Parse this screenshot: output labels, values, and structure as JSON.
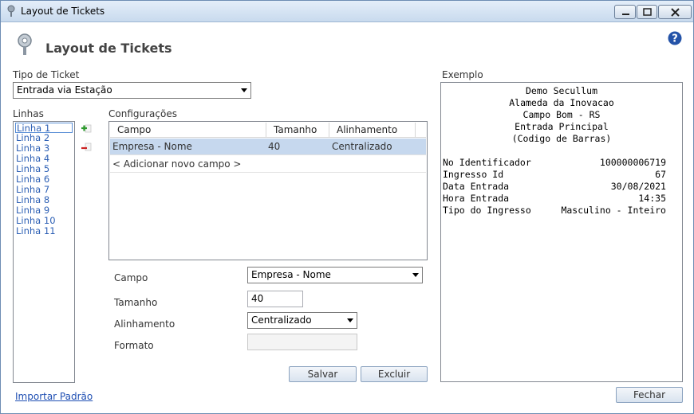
{
  "window": {
    "title": "Layout de Tickets"
  },
  "header": {
    "title": "Layout de Tickets"
  },
  "ticket_type": {
    "label": "Tipo de Ticket",
    "selected": "Entrada via Estação"
  },
  "lines": {
    "label": "Linhas",
    "items": [
      "Linha 1",
      "Linha 2",
      "Linha 3",
      "Linha 4",
      "Linha 5",
      "Linha 6",
      "Linha 7",
      "Linha 8",
      "Linha 9",
      "Linha 10",
      "Linha 11"
    ],
    "selected_index": 0
  },
  "config": {
    "label": "Configurações",
    "columns": [
      "Campo",
      "Tamanho",
      "Alinhamento"
    ],
    "rows": [
      {
        "campo": "Empresa - Nome",
        "tamanho": "40",
        "alinhamento": "Centralizado"
      }
    ],
    "add_row": "< Adicionar novo campo >"
  },
  "form": {
    "campo_label": "Campo",
    "campo_value": "Empresa - Nome",
    "tamanho_label": "Tamanho",
    "tamanho_value": "40",
    "alinhamento_label": "Alinhamento",
    "alinhamento_value": "Centralizado",
    "formato_label": "Formato",
    "formato_value": ""
  },
  "buttons": {
    "salvar": "Salvar",
    "excluir": "Excluir",
    "fechar": "Fechar"
  },
  "import_link": "Importar Padrão",
  "example": {
    "label": "Exemplo",
    "header_lines": [
      "Demo Secullum",
      "Alameda da Inovacao",
      "Campo Bom - RS",
      "Entrada Principal",
      "(Codigo de Barras)"
    ],
    "fields": [
      {
        "key": "No Identificador",
        "value": "100000006719"
      },
      {
        "key": "Ingresso Id",
        "value": "67"
      },
      {
        "key": "Data Entrada",
        "value": "30/08/2021"
      },
      {
        "key": "Hora Entrada",
        "value": "14:35"
      },
      {
        "key": "Tipo do Ingresso",
        "value": "Masculino - Inteiro"
      }
    ]
  },
  "colors": {
    "accent": "#2c5fb4",
    "selection": "#c6d8ee",
    "link": "#1f4fb3"
  }
}
